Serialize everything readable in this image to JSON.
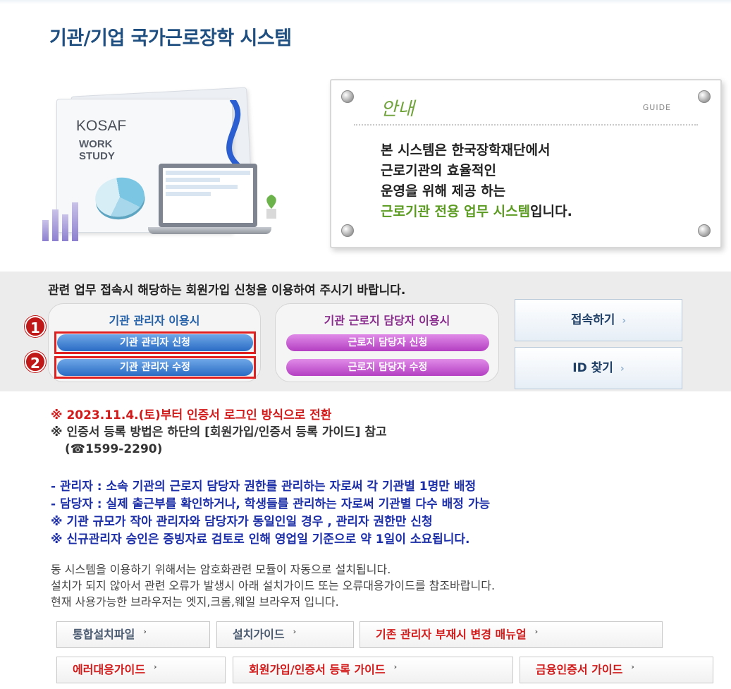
{
  "page": {
    "title": "기관/기업 국가근로장학 시스템"
  },
  "hero": {
    "brand_line1": "KOSAF",
    "brand_line2": "WORK",
    "brand_line3": "STUDY"
  },
  "guide": {
    "title": "안내",
    "title_en": "GUIDE",
    "line1": "본 시스템은 한국장학재단에서",
    "line2": "근로기관의 효율적인",
    "line3": "운영을 위해 제공 하는",
    "line4_highlight": "근로기관 전용 업무 시스템",
    "line4_tail": "입니다."
  },
  "login": {
    "note": "관련 업무 접속시 해당하는 회원가입 신청을 이용하여 주시기 바랍니다.",
    "admin_group_title": "기관 관리자 이용시",
    "admin_apply": "기관 관리자 신청",
    "admin_edit": "기관 관리자 수정",
    "staff_group_title": "기관 근로지 담당자 이용시",
    "staff_apply": "근로지 담당자 신청",
    "staff_edit": "근로지 담당자 수정",
    "connect": "접속하기",
    "find_id": "ID 찾기",
    "marker1": "1",
    "marker2": "2",
    "chevron": "›"
  },
  "notices": {
    "red": "※ 2023.11.4.(토)부터 인증서 로그인 방식으로 전환",
    "dark1": "※ 인증서 등록 방법은 하단의 [회원가입/인증서 등록 가이드] 참고",
    "dark2": "(☎1599-2290)",
    "blue1": "- 관리자 : 소속 기관의 근로지 담당자 권한를 관리하는 자로써 각 기관별 1명만 배정",
    "blue2": "- 담당자 : 실제 출근부를 확인하거나, 학생들를 관리하는 자로써 기관별 다수 배정 가능",
    "blue3": "※ 기관 규모가 작아 관리자와 담당자가 동일인일 경우 , 관리자 권한만 신청",
    "blue4": "※ 신규관리자 승인은 증빙자료 검토로 인해 영업일 기준으로 약 1일이 소요됩니다.",
    "gray1": "동 시스템을 이용하기 위해서는 암호화관련 모듈이 자동으로 설치됩니다.",
    "gray2": "설치가 되지 않아서 관련 오류가 발생시 아래 설치가이드 또는 오류대응가이드를 참조바랍니다.",
    "gray3": "현재 사용가능한 브라우저는 엣지,크롬,웨일 브라우저 입니다."
  },
  "guide_buttons": {
    "install_file": "통합설치파일",
    "install_guide": "설치가이드",
    "change_manual": "기존 관리자 부재시 변경 매뉴얼",
    "error_guide": "에러대응가이드",
    "signup_guide": "회원가입/인증서 등록 가이드",
    "finance_cert_guide": "금융인증서 가이드",
    "caret": "›"
  }
}
